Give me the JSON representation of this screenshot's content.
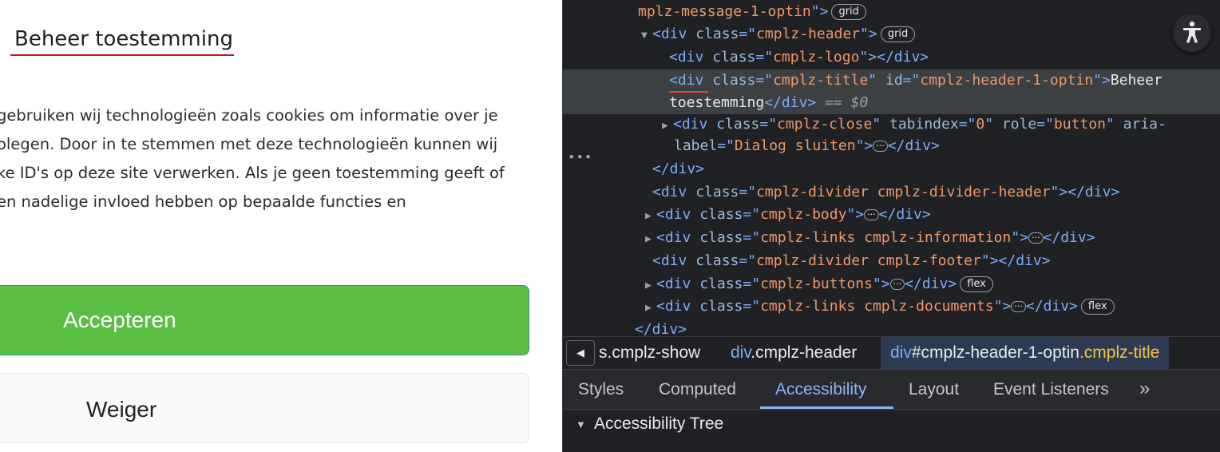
{
  "consent": {
    "title": "Beheer toestemming",
    "body_lines": [
      "gebruiken wij technologieën zoals cookies om informatie over je",
      "olegen. Door in te stemmen met deze technologieën kunnen wij",
      "ke ID's op deze site verwerken. Als je geen toestemming geeft of",
      "en nadelige invloed hebben op bepaalde functies en"
    ],
    "accept_label": "Accepteren",
    "deny_label": "Weiger",
    "accept_color": "#5bbe44"
  },
  "devtools": {
    "elements": {
      "r0": {
        "val": "mplz-message-1-optin",
        "end": "\">",
        "badge": "grid"
      },
      "r1": {
        "tri": "▼",
        "open": "<div",
        "attr": "class",
        "eq": "=\"",
        "val": "cmplz-header",
        "end": "\">",
        "badge": "grid"
      },
      "r2": {
        "open": "<div",
        "attr": "class",
        "eq": "=\"",
        "val": "cmplz-logo",
        "end": "\"></div>"
      },
      "r3": {
        "dots": "•••",
        "open": "<div",
        "attr": "class",
        "eq": "=\"",
        "val": "cmplz-title",
        "q": "\"",
        "attr2": "id",
        "eq2": "=\"",
        "val2": "cmplz-header-1-optin",
        "end": "\">",
        "text": "Beheer"
      },
      "r4": {
        "text": "toestemming",
        "close": "</div>",
        "marker": "== $0"
      },
      "r5": {
        "tri": "▶",
        "open": "<div",
        "attr": "class",
        "eq": "=\"",
        "val": "cmplz-close",
        "q": "\"",
        "attr2": "tabindex",
        "eq2": "=\"",
        "val2": "0",
        "q2": "\"",
        "attr3": "role",
        "eq3": "=\"",
        "val3": "button",
        "q3": "\"",
        "attr4": "aria-"
      },
      "r6": {
        "attr": "label",
        "eq": "=\"",
        "val": "Dialog sluiten",
        "end": "\">",
        "ell": "···",
        "close": "</div>"
      },
      "r7": {
        "close": "</div>"
      },
      "r8": {
        "open": "<div",
        "attr": "class",
        "eq": "=\"",
        "val": "cmplz-divider cmplz-divider-header",
        "end": "\"></div>"
      },
      "r9": {
        "tri": "▶",
        "open": "<div",
        "attr": "class",
        "eq": "=\"",
        "val": "cmplz-body",
        "end": "\">",
        "ell": "···",
        "close": "</div>"
      },
      "r10": {
        "tri": "▶",
        "open": "<div",
        "attr": "class",
        "eq": "=\"",
        "val": "cmplz-links cmplz-information",
        "end": "\">",
        "ell": "···",
        "close": "</div>"
      },
      "r11": {
        "open": "<div",
        "attr": "class",
        "eq": "=\"",
        "val": "cmplz-divider cmplz-footer",
        "end": "\"></div>"
      },
      "r12": {
        "tri": "▶",
        "open": "<div",
        "attr": "class",
        "eq": "=\"",
        "val": "cmplz-buttons",
        "end": "\">",
        "ell": "···",
        "close": "</div>",
        "badge": "flex"
      },
      "r13": {
        "tri": "▶",
        "open": "<div",
        "attr": "class",
        "eq": "=\"",
        "val": "cmplz-links cmplz-documents",
        "end": "\">",
        "ell": "···",
        "close": "</div>",
        "badge": "flex"
      },
      "r14": {
        "close": "</div>"
      }
    },
    "accessibility_icon": "accessibility-person-icon",
    "breadcrumbs": {
      "back": "◀",
      "c1": "s.cmplz-show",
      "c2_tag": "div",
      "c2_cls": ".cmplz-header",
      "c3_tag": "div",
      "c3_id": "#cmplz-header-1-optin",
      "c3_cls": ".cmplz-title"
    },
    "tabs": {
      "styles": "Styles",
      "computed": "Computed",
      "accessibility": "Accessibility",
      "layout": "Layout",
      "event_listeners": "Event Listeners",
      "more": "»"
    },
    "tree": {
      "toggle": "▼",
      "title": "Accessibility Tree"
    }
  }
}
